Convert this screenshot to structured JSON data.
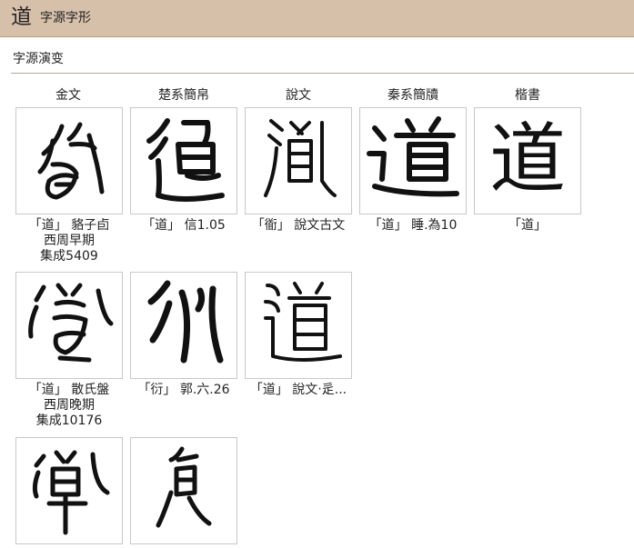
{
  "header": {
    "char": "道",
    "title": "字源字形"
  },
  "section": {
    "label": "字源演变"
  },
  "columns": [
    "金文",
    "楚系簡帛",
    "說文",
    "秦系簡牘",
    "楷書"
  ],
  "cards": [
    {
      "id": "c1",
      "lines": [
        "「道」 貉子卣",
        "西周早期",
        "集成5409"
      ]
    },
    {
      "id": "c2",
      "lines": [
        "「道」 信1.05"
      ]
    },
    {
      "id": "c3",
      "lines": [
        "「衜」 說文古文"
      ]
    },
    {
      "id": "c4",
      "lines": [
        "「道」 睡.為10"
      ]
    },
    {
      "id": "c5",
      "char": "道",
      "lines": [
        "「道」"
      ]
    },
    {
      "id": "c6",
      "lines": [
        "「道」 散氏盤",
        "西周晚期",
        "集成10176"
      ]
    },
    {
      "id": "c7",
      "lines": [
        "「衍」 郭.六.26"
      ]
    },
    {
      "id": "c8",
      "lines": [
        "「道」 說文‧辵..."
      ]
    },
    {
      "id": "c9",
      "lines": []
    },
    {
      "id": "c10",
      "lines": []
    }
  ]
}
